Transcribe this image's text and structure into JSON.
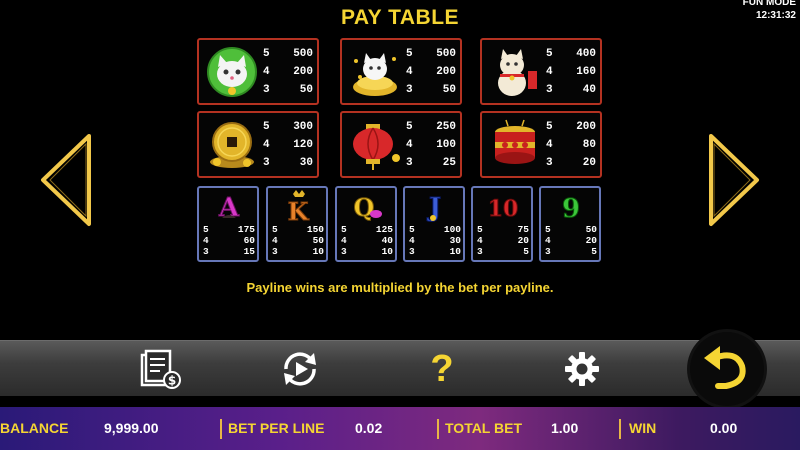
{
  "title": "PAY TABLE",
  "mode": {
    "label": "FUN MODE",
    "time": "12:31:32"
  },
  "big_symbols": [
    {
      "icon": "white-cat-coin-icon",
      "pays": [
        {
          "count": "5",
          "amount": "500"
        },
        {
          "count": "4",
          "amount": "200"
        },
        {
          "count": "3",
          "amount": "50"
        }
      ]
    },
    {
      "icon": "cat-gold-pot-icon",
      "pays": [
        {
          "count": "5",
          "amount": "500"
        },
        {
          "count": "4",
          "amount": "200"
        },
        {
          "count": "3",
          "amount": "50"
        }
      ]
    },
    {
      "icon": "lucky-cat-icon",
      "pays": [
        {
          "count": "5",
          "amount": "400"
        },
        {
          "count": "4",
          "amount": "160"
        },
        {
          "count": "3",
          "amount": "40"
        }
      ]
    },
    {
      "icon": "gold-coin-icon",
      "pays": [
        {
          "count": "5",
          "amount": "300"
        },
        {
          "count": "4",
          "amount": "120"
        },
        {
          "count": "3",
          "amount": "30"
        }
      ]
    },
    {
      "icon": "red-lantern-icon",
      "pays": [
        {
          "count": "5",
          "amount": "250"
        },
        {
          "count": "4",
          "amount": "100"
        },
        {
          "count": "3",
          "amount": "25"
        }
      ]
    },
    {
      "icon": "firecracker-drum-icon",
      "pays": [
        {
          "count": "5",
          "amount": "200"
        },
        {
          "count": "4",
          "amount": "80"
        },
        {
          "count": "3",
          "amount": "20"
        }
      ]
    }
  ],
  "small_symbols": [
    {
      "symbol": "A",
      "color": "#d838c8",
      "pays": [
        {
          "count": "5",
          "amount": "175"
        },
        {
          "count": "4",
          "amount": "60"
        },
        {
          "count": "3",
          "amount": "15"
        }
      ]
    },
    {
      "symbol": "K",
      "color": "#e8822a",
      "pays": [
        {
          "count": "5",
          "amount": "150"
        },
        {
          "count": "4",
          "amount": "50"
        },
        {
          "count": "3",
          "amount": "10"
        }
      ]
    },
    {
      "symbol": "Q",
      "color": "#f0c52a",
      "pays": [
        {
          "count": "5",
          "amount": "125"
        },
        {
          "count": "4",
          "amount": "40"
        },
        {
          "count": "3",
          "amount": "10"
        }
      ]
    },
    {
      "symbol": "J",
      "color": "#3c5ed8",
      "pays": [
        {
          "count": "5",
          "amount": "100"
        },
        {
          "count": "4",
          "amount": "30"
        },
        {
          "count": "3",
          "amount": "10"
        }
      ]
    },
    {
      "symbol": "10",
      "color": "#d8282a",
      "pays": [
        {
          "count": "5",
          "amount": "75"
        },
        {
          "count": "4",
          "amount": "20"
        },
        {
          "count": "3",
          "amount": "5"
        }
      ]
    },
    {
      "symbol": "9",
      "color": "#3cc63a",
      "pays": [
        {
          "count": "5",
          "amount": "50"
        },
        {
          "count": "4",
          "amount": "20"
        },
        {
          "count": "3",
          "amount": "5"
        }
      ]
    }
  ],
  "note": "Payline wins are multiplied by the bet per payline.",
  "toolbar": {
    "buttons": [
      "bet-settings-icon",
      "autospin-icon",
      "help-icon",
      "gear-icon"
    ],
    "help_glyph": "?",
    "back": "back-icon"
  },
  "status": {
    "balance_label": "BALANCE",
    "balance_value": "9,999.00",
    "bet_per_line_label": "BET PER LINE",
    "bet_per_line_value": "0.02",
    "total_bet_label": "TOTAL BET",
    "total_bet_value": "1.00",
    "win_label": "WIN",
    "win_value": "0.00"
  },
  "colors": {
    "accent": "#f5d533",
    "big_border": "#b43221",
    "small_border": "#6677b8"
  }
}
